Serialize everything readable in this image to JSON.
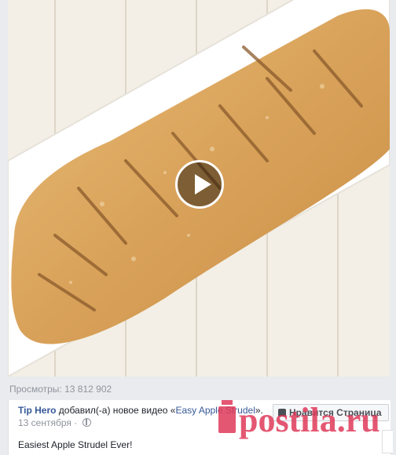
{
  "video": {
    "thumbnail_icon": "apple-strudel-image",
    "play_icon": "play-icon"
  },
  "stats": {
    "views_label": "Просмотры:",
    "views_count": "13 812 902"
  },
  "post": {
    "author": "Tip Hero",
    "action_text": " добавил(-а) новое видео «",
    "video_title": "Easy Apple Strudel",
    "action_suffix": "».",
    "date": "13 сентября",
    "separator": " · ",
    "description": "Easiest Apple Strudel Ever!"
  },
  "like_button": {
    "label": "Нравится Страница"
  },
  "watermark": {
    "text": "postila.ru",
    "color": "#e03a5a"
  },
  "colors": {
    "link": "#365899",
    "meta": "#90949c",
    "pastry": "#d9a75f"
  }
}
